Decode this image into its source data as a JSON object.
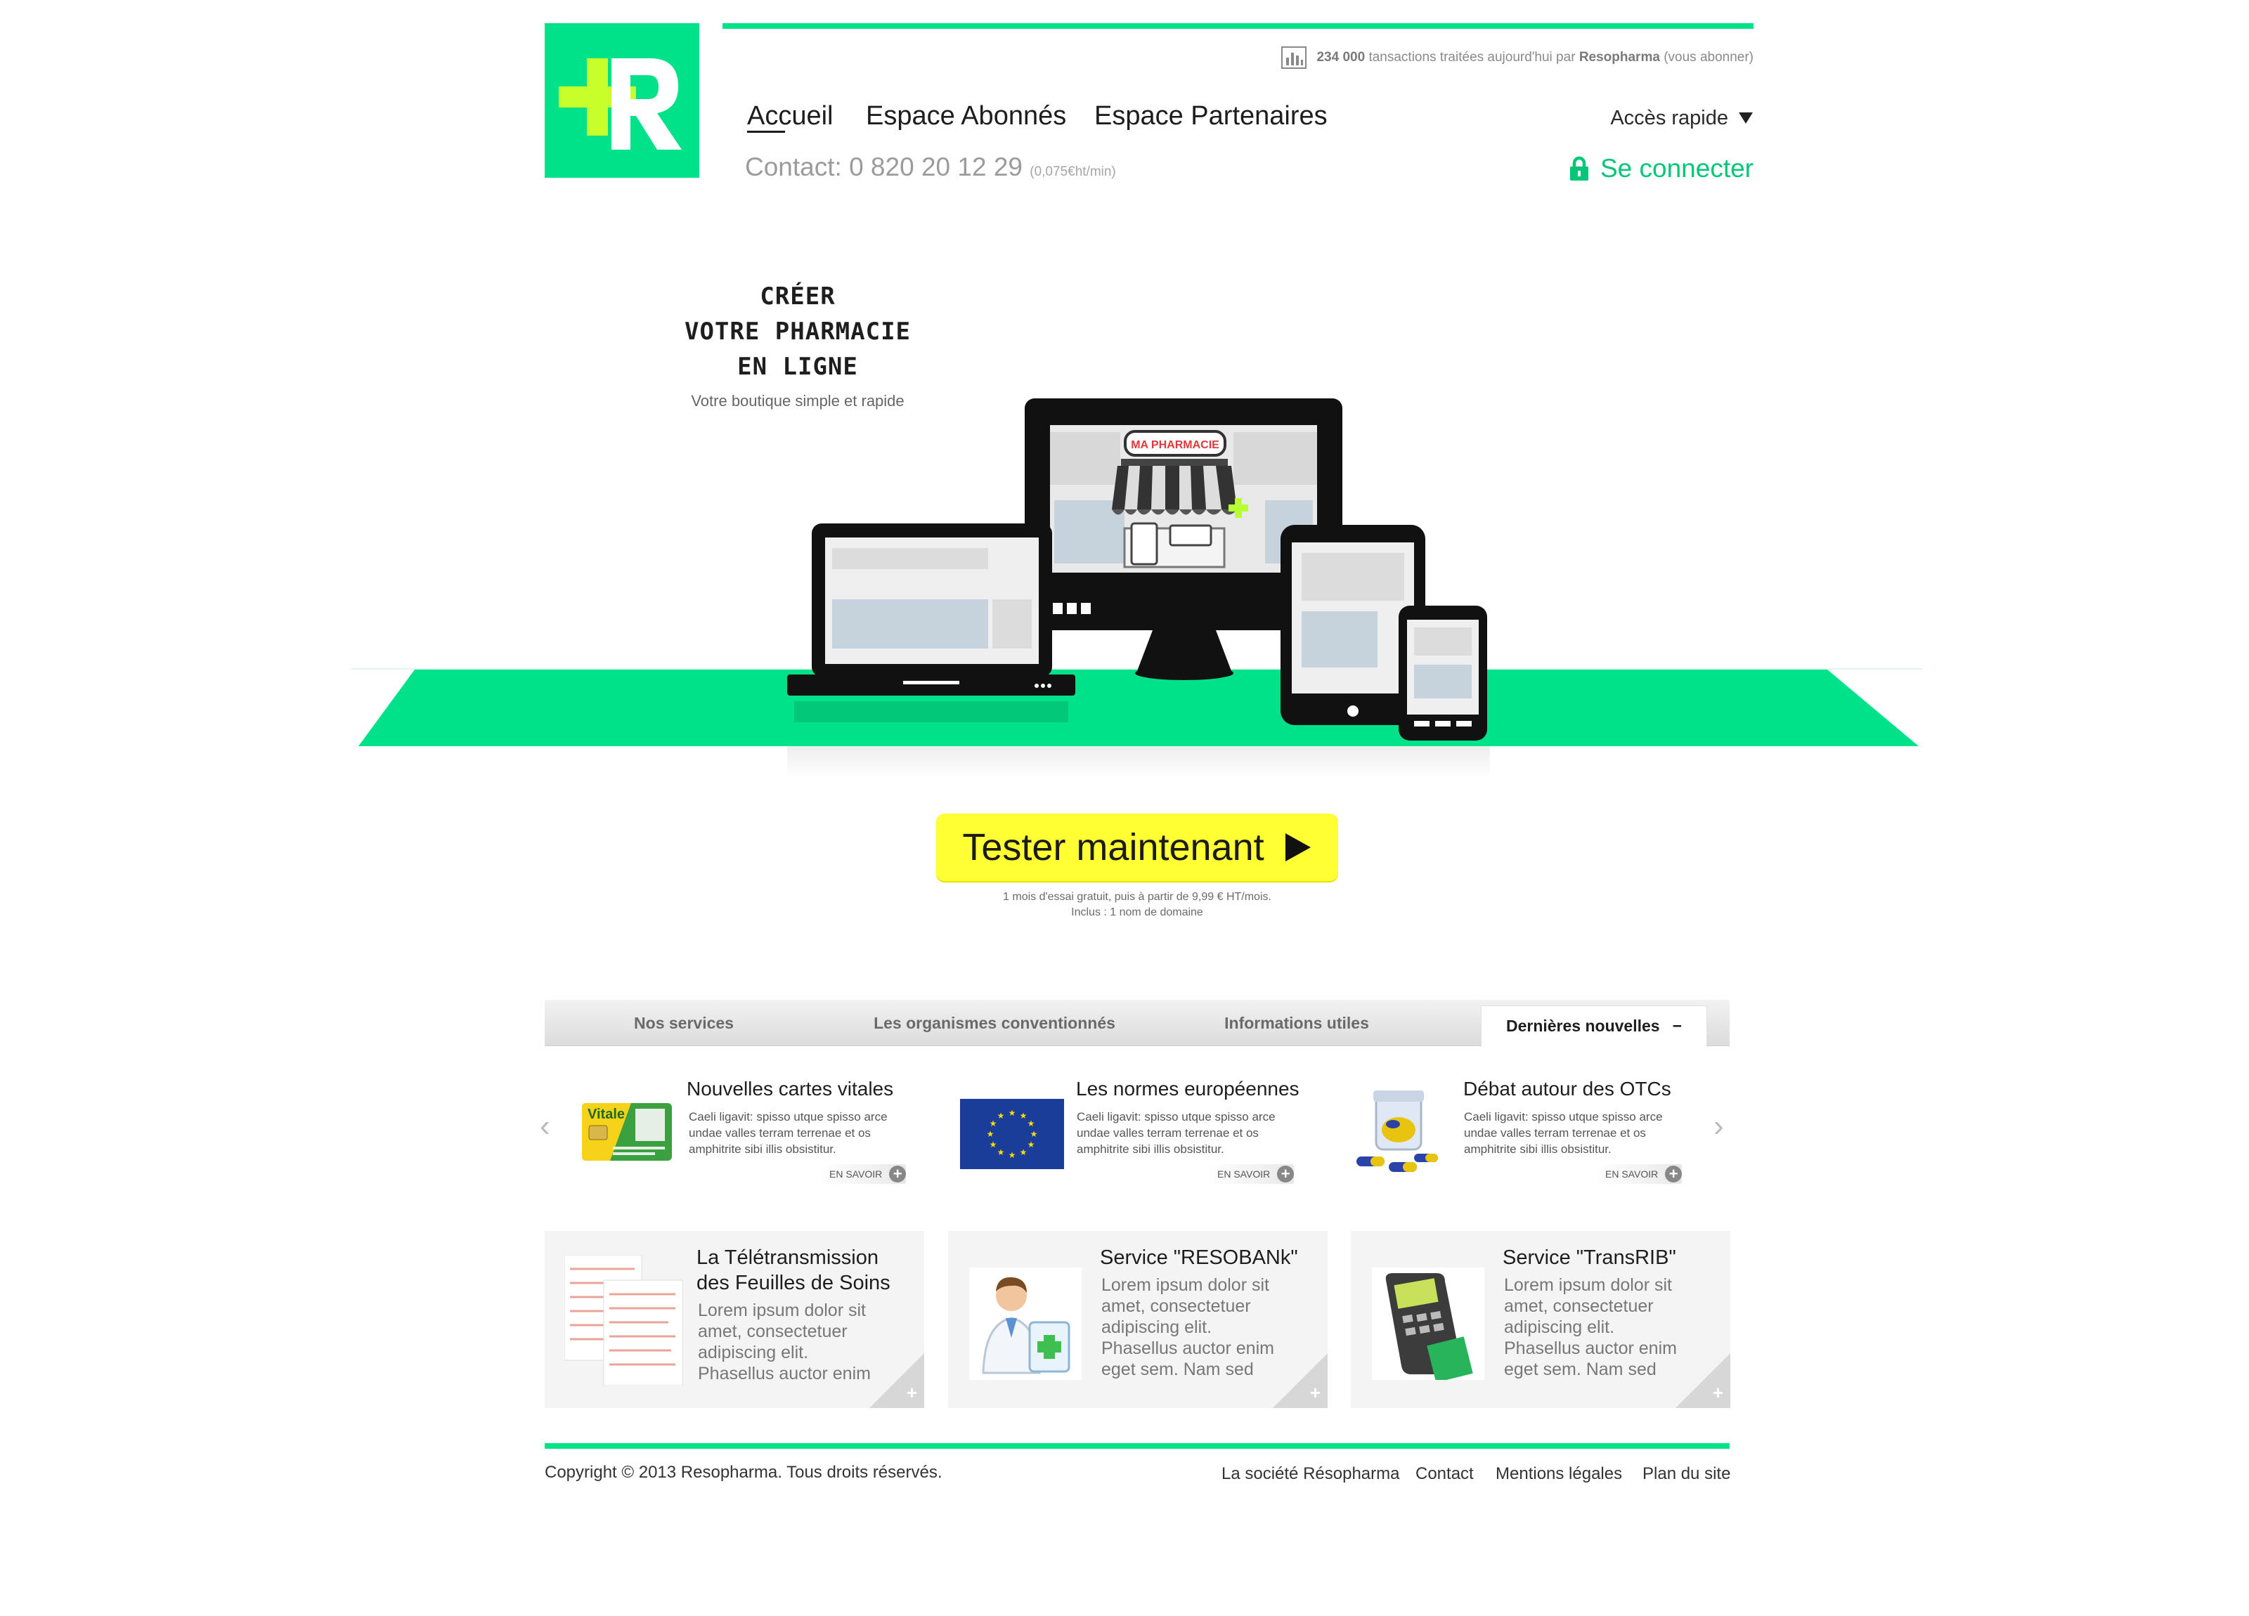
{
  "brand": {
    "logo_text": "+R",
    "colors": {
      "primary": "#00e289",
      "cta": "#ffff33",
      "logo_plus": "#c8ff2a",
      "pharmacy_plus": "#b7ff2f"
    }
  },
  "header": {
    "stats": {
      "count": "234 000",
      "text": "tansactions traitées aujourd'hui par",
      "brand": "Resopharma",
      "subscribe": "(vous abonner)"
    },
    "nav": [
      "Accueil",
      "Espace Abonnés",
      "Espace Partenaires"
    ],
    "contact": {
      "label": "Contact: 0 820 20 12 29",
      "rate": "(0,075€ht/min)"
    },
    "quick_access": "Accès rapide",
    "login": "Se connecter"
  },
  "hero": {
    "title_lines": [
      "CRÉER",
      "VOTRE PHARMACIE",
      "EN LIGNE"
    ],
    "subtitle": "Votre boutique simple et rapide",
    "shop_sign": "MA PHARMACIE"
  },
  "cta": {
    "label": "Tester maintenant",
    "note_line1": "1 mois d'essai gratuit, puis à partir de 9,99 € HT/mois.",
    "note_line2": "Inclus : 1 nom de domaine"
  },
  "tabs": {
    "items": [
      "Nos services",
      "Les organismes conventionnés",
      "Informations utiles"
    ],
    "active": "Dernières nouvelles",
    "active_symbol": "−"
  },
  "news": [
    {
      "title": "Nouvelles cartes vitales",
      "body": "Caeli ligavit: spisso utque spisso arce undae valles terram terrenae et os amphitrite sibi illis obsistitur.",
      "more": "EN SAVOIR",
      "card_text": "Vitale"
    },
    {
      "title": "Les normes européennes",
      "body": "Caeli ligavit: spisso utque spisso arce undae valles terram terrenae et os amphitrite sibi illis obsistitur.",
      "more": "EN SAVOIR"
    },
    {
      "title": "Débat autour des OTCs",
      "body": "Caeli ligavit: spisso utque spisso arce undae valles terram terrenae et os amphitrite sibi illis obsistitur.",
      "more": "EN SAVOIR"
    }
  ],
  "services": [
    {
      "title_lines": [
        "La Télétransmission",
        "des Feuilles de Soins"
      ],
      "body_lines": [
        "Lorem ipsum dolor sit",
        "amet, consectetuer",
        "adipiscing elit.",
        "Phasellus auctor enim"
      ]
    },
    {
      "title_lines": [
        "Service \"RESOBANk\""
      ],
      "body_lines": [
        "Lorem ipsum dolor sit",
        "amet, consectetuer",
        "adipiscing elit.",
        "Phasellus auctor enim",
        "eget sem. Nam sed"
      ]
    },
    {
      "title_lines": [
        "Service \"TransRIB\""
      ],
      "body_lines": [
        "Lorem ipsum dolor sit",
        "amet, consectetuer",
        "adipiscing elit.",
        "Phasellus auctor enim",
        "eget sem. Nam sed"
      ]
    }
  ],
  "footer": {
    "copyright": "Copyright © 2013 Resopharma. Tous droits réservés.",
    "links": [
      "La société Résopharma",
      "Contact",
      "Mentions légales",
      "Plan du site"
    ]
  }
}
